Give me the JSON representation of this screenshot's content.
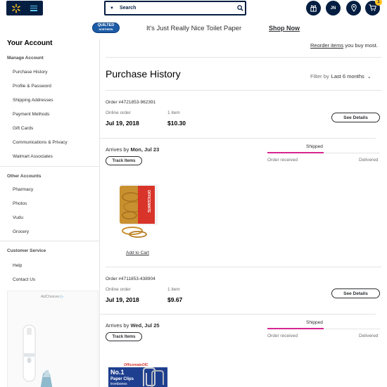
{
  "header": {
    "search_placeholder": "Search",
    "user_initials": "JN",
    "cart_count": "1",
    "colors": {
      "navy": "#041e42",
      "spark_yellow": "#ffc220",
      "menu_blue": "#5ec8f2"
    },
    "icons": [
      "walmart-spark-icon",
      "menu-icon",
      "chevron-down-icon",
      "search-icon",
      "services-icon",
      "location-pin-icon",
      "cart-icon"
    ]
  },
  "banner": {
    "logo_text": "QUILTED",
    "logo_sub": "NORTHERN",
    "tagline": "It's Just Really Nice Toilet Paper",
    "cta": "Shop Now"
  },
  "sidebar": {
    "title": "Your Account",
    "sections": [
      {
        "label": "Manage Account",
        "items": [
          "Purchase History",
          "Profile & Password",
          "Shipping Addresses",
          "Payment Methods",
          "Gift Cards",
          "Communications & Privacy",
          "Walmart Associates"
        ]
      },
      {
        "label": "Other Accounts",
        "items": [
          "Pharmacy",
          "Photos",
          "Vudu",
          "Grocery"
        ]
      },
      {
        "label": "Customer Service",
        "items": [
          "Help",
          "Contact Us"
        ]
      }
    ],
    "ad_label": "AdChoices"
  },
  "main": {
    "reorder_prefix": "",
    "reorder_link": "Reorder items",
    "reorder_suffix": " you buy most.",
    "page_title": "Purchase History",
    "filter_label": "Filter by",
    "filter_value": "Last 6 months",
    "orders": [
      {
        "number": "Order #4721853-962391",
        "type": "Online order",
        "date": "Jul 19, 2018",
        "items_label": "1 item",
        "total": "$10.30",
        "details_label": "See Details",
        "arrives_prefix": "Arrives by",
        "arrives_date": "Mon, Jul 23",
        "track_label": "Track Items",
        "status": "Shipped",
        "progress_start": "Order received",
        "progress_end": "Delivered",
        "progress_fraction": 0.5,
        "add_to_cart": "Add to Cart"
      },
      {
        "number": "Order #4711853-438904",
        "type": "Online order",
        "date": "Jul 19, 2018",
        "items_label": "1 item",
        "total": "$9.67",
        "details_label": "See Details",
        "arrives_prefix": "Arrives by",
        "arrives_date": "Wed, Jul 25",
        "track_label": "Track Items",
        "status": "Shipped",
        "progress_start": "Order received",
        "progress_end": "Delivered",
        "progress_fraction": 0.5,
        "product_box_brand": "OfficemateOIC",
        "product_box_title": "No.1",
        "product_box_sub": "Paper Clips",
        "product_box_sub2": "trombones"
      }
    ],
    "product_package_text": "OFFICEMATE"
  }
}
